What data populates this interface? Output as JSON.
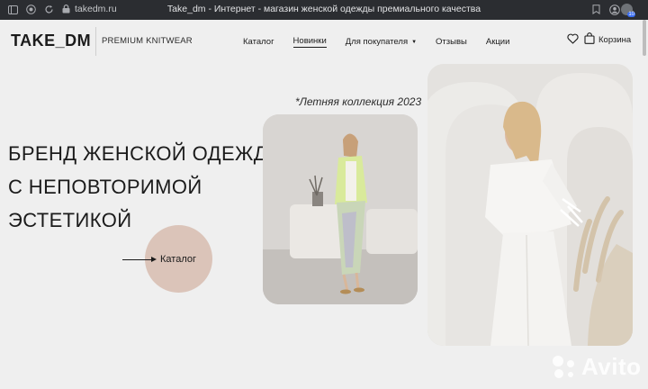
{
  "browser": {
    "url": "takedm.ru",
    "title": "Take_dm - Интернет - магазин женской одежды премиального качества",
    "extension_badge": "10"
  },
  "header": {
    "logo": "TAKE_DM",
    "tagline": "PREMIUM KNITWEAR",
    "nav": [
      {
        "label": "Каталог",
        "active": false
      },
      {
        "label": "Новинки",
        "active": true
      },
      {
        "label": "Для покупателя",
        "active": false,
        "dropdown": true
      },
      {
        "label": "Отзывы",
        "active": false
      },
      {
        "label": "Акции",
        "active": false
      }
    ],
    "cart_label": "Корзина"
  },
  "hero": {
    "collection_label": "*Летняя коллекция 2023",
    "headline": [
      "БРЕНД ЖЕНСКОЙ ОДЕЖДЫ",
      "С НЕПОВТОРИМОЙ",
      "ЭСТЕТИКОЙ"
    ],
    "cta_label": "Каталог"
  },
  "watermark": {
    "text": "Avito"
  },
  "colors": {
    "background": "#efefef",
    "accent_circle": "#dbc4b9",
    "text": "#1b1b1b"
  }
}
